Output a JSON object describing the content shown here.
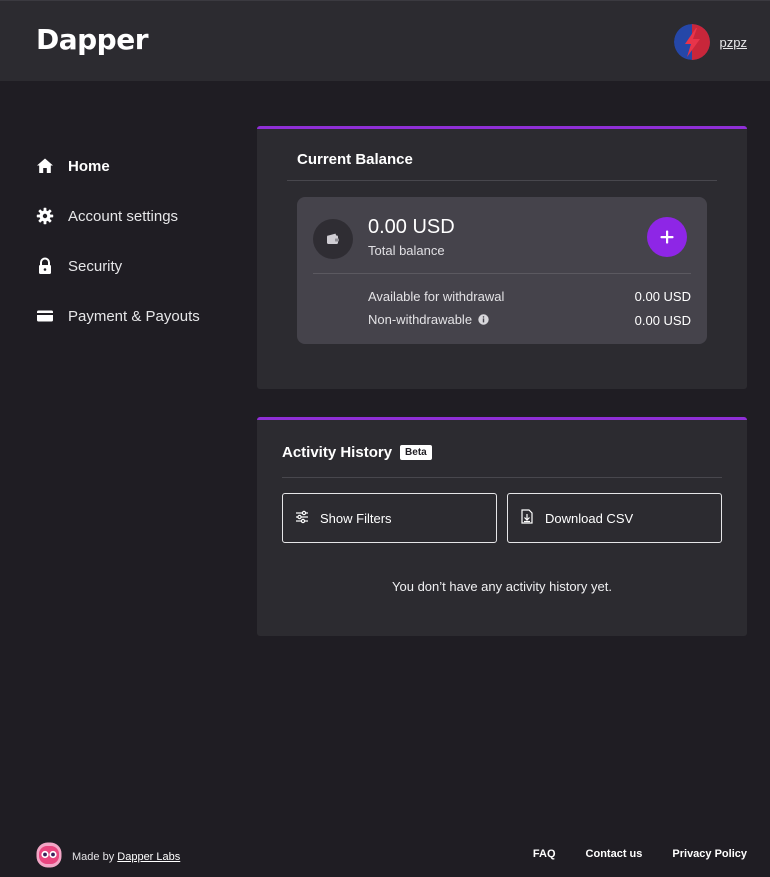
{
  "header": {
    "logo": "Dapper",
    "username": "pzpz",
    "avatar_icon": "lightning-avatar-icon"
  },
  "sidebar": {
    "items": [
      {
        "label": "Home",
        "icon": "home-icon",
        "active": true
      },
      {
        "label": "Account settings",
        "icon": "gear-icon",
        "active": false
      },
      {
        "label": "Security",
        "icon": "lock-icon",
        "active": false
      },
      {
        "label": "Payment & Payouts",
        "icon": "card-icon",
        "active": false
      }
    ]
  },
  "balance": {
    "title": "Current Balance",
    "amount": "0.00 USD",
    "amount_label": "Total balance",
    "available_label": "Available for withdrawal",
    "available_value": "0.00 USD",
    "nonwithdrawable_label": "Non-withdrawable",
    "nonwithdrawable_value": "0.00 USD"
  },
  "activity": {
    "title": "Activity History",
    "badge": "Beta",
    "filters_label": "Show Filters",
    "csv_label": "Download CSV",
    "empty_message": "You don’t have any activity history yet."
  },
  "footer": {
    "made_by_prefix": "Made by",
    "made_by_link": "Dapper Labs",
    "links": [
      "FAQ",
      "Contact us",
      "Privacy Policy"
    ]
  },
  "colors": {
    "background": "#1f1d23",
    "card": "#2c2b30",
    "accent": "#8e26e6",
    "card_border": "#8f2fd6"
  }
}
